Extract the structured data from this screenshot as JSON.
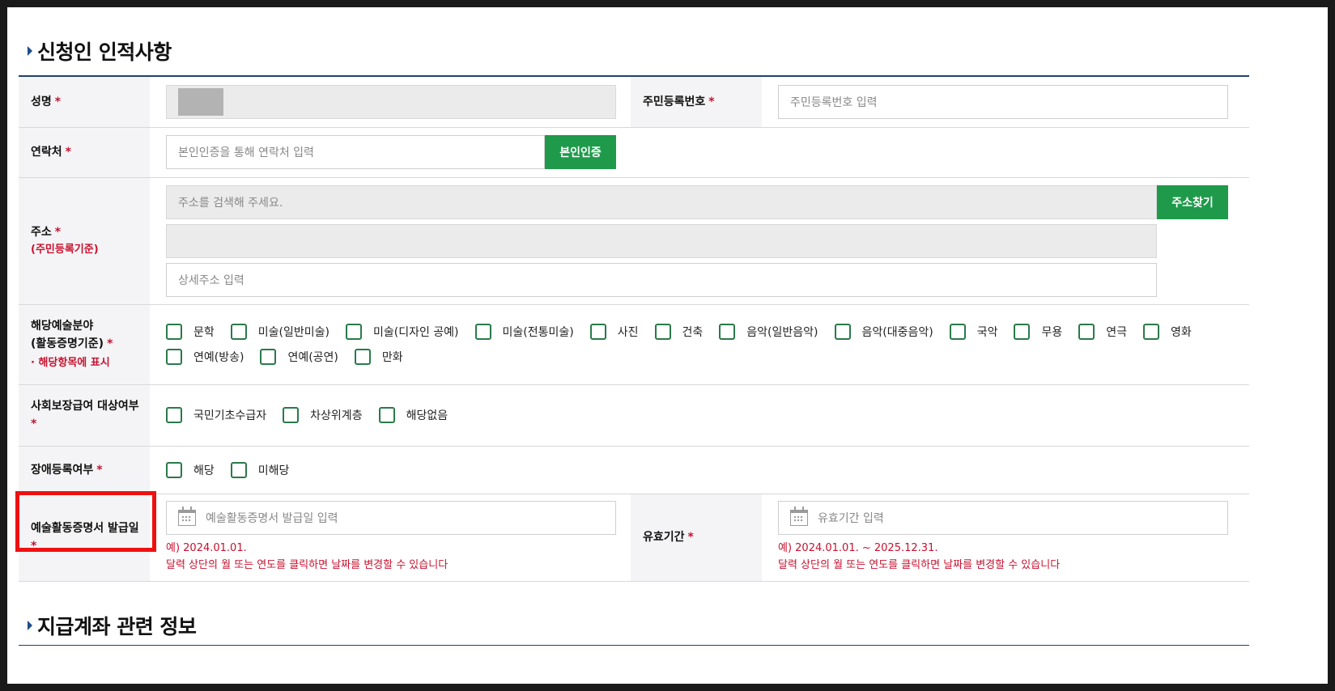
{
  "sections": {
    "applicant_title": "신청인 인적사항",
    "account_title": "지급계좌 관련 정보"
  },
  "required_mark": "*",
  "fields": {
    "name": {
      "label": "성명"
    },
    "rrn": {
      "label": "주민등록번호",
      "placeholder": "주민등록번호 입력"
    },
    "contact": {
      "label": "연락처",
      "placeholder": "본인인증을 통해 연락처 입력",
      "button": "본인인증"
    },
    "address": {
      "label": "주소",
      "sub_label": "(주민등록기준)",
      "search_placeholder": "주소를 검색해 주세요.",
      "button": "주소찾기",
      "detail_placeholder": "상세주소 입력"
    },
    "art_field": {
      "label_line1": "해당예술분야",
      "label_line2": "(활동증명기준)",
      "note": "· 해당항목에 표시",
      "options": [
        "문학",
        "미술(일반미술)",
        "미술(디자인 공예)",
        "미술(전통미술)",
        "사진",
        "건축",
        "음악(일반음악)",
        "음악(대중음악)",
        "국악",
        "무용",
        "연극",
        "영화",
        "연예(방송)",
        "연예(공연)",
        "만화"
      ]
    },
    "social_security": {
      "label": "사회보장급여 대상여부",
      "options": [
        "국민기초수급자",
        "차상위계층",
        "해당없음"
      ]
    },
    "disability": {
      "label": "장애등록여부",
      "options": [
        "해당",
        "미해당"
      ]
    },
    "issue_date": {
      "label": "예술활동증명서 발급일",
      "placeholder": "예술활동증명서 발급일 입력",
      "hint_example": "예) 2024.01.01.",
      "hint_help": "달력 상단의 월 또는 연도를 클릭하면 날짜를 변경할 수 있습니다"
    },
    "validity": {
      "label": "유효기간",
      "placeholder": "유효기간 입력",
      "hint_example": "예) 2024.01.01. ~ 2025.12.31.",
      "hint_help": "달력 상단의 월 또는 연도를 클릭하면 날짜를 변경할 수 있습니다"
    }
  },
  "colors": {
    "accent_green": "#1e9a4a",
    "required_red": "#c8102e",
    "highlight_red": "#ee1111",
    "header_navy": "#22406e"
  }
}
